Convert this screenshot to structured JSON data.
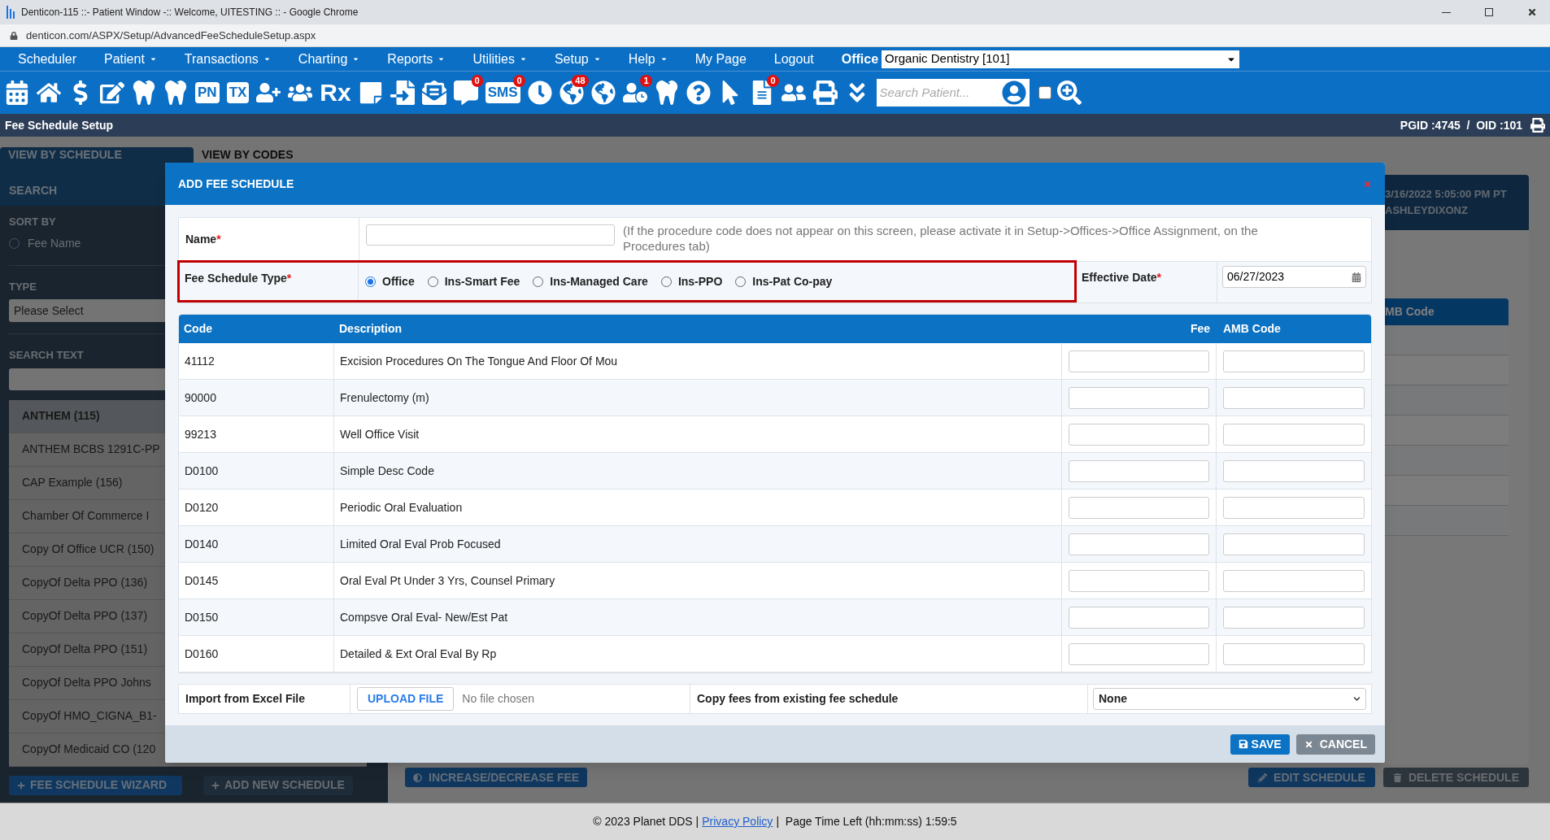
{
  "window": {
    "title": "Denticon-115 ::- Patient Window -:: Welcome, UITESTING :: - Google Chrome",
    "url": "denticon.com/ASPX/Setup/AdvancedFeeScheduleSetup.aspx"
  },
  "menu": [
    {
      "label": "Scheduler",
      "has_menu": false
    },
    {
      "label": "Patient",
      "has_menu": true
    },
    {
      "label": "Transactions",
      "has_menu": true
    },
    {
      "label": "Charting",
      "has_menu": true
    },
    {
      "label": "Reports",
      "has_menu": true
    },
    {
      "label": "Utilities",
      "has_menu": true
    },
    {
      "label": "Setup",
      "has_menu": true
    },
    {
      "label": "Help",
      "has_menu": true
    },
    {
      "label": "My Page",
      "has_menu": false
    },
    {
      "label": "Logout",
      "has_menu": false
    }
  ],
  "office": {
    "label": "Office",
    "value": "Organic Dentistry [101]"
  },
  "toolbar": [
    {
      "kind": "calendar"
    },
    {
      "kind": "home"
    },
    {
      "kind": "dollar"
    },
    {
      "kind": "edit"
    },
    {
      "kind": "tooth-card"
    },
    {
      "kind": "teeth"
    },
    {
      "kind": "text-card",
      "label": "PN"
    },
    {
      "kind": "text-card",
      "label": "TX"
    },
    {
      "kind": "user-plus"
    },
    {
      "kind": "users-plus"
    },
    {
      "kind": "text",
      "label": "Rx"
    },
    {
      "kind": "note"
    },
    {
      "kind": "scan"
    },
    {
      "kind": "mail"
    },
    {
      "kind": "chat",
      "badge": "0"
    },
    {
      "kind": "text-bubble",
      "label": "SMS",
      "badge": "0"
    },
    {
      "kind": "clock"
    },
    {
      "kind": "globe-user",
      "badge": "48"
    },
    {
      "kind": "globe-user"
    },
    {
      "kind": "user-sync",
      "badge": "1"
    },
    {
      "kind": "tooth"
    },
    {
      "kind": "question"
    },
    {
      "kind": "globe-pointer"
    },
    {
      "kind": "doc-check",
      "badge": "0"
    },
    {
      "kind": "family"
    },
    {
      "kind": "printer"
    },
    {
      "kind": "chevrons"
    }
  ],
  "patient_search": {
    "placeholder": "Search Patient...",
    "checked": false
  },
  "page_header": {
    "title": "Fee Schedule Setup",
    "ids": "PGID :4745  /  OID :101"
  },
  "tabs": [
    {
      "label": "VIEW BY SCHEDULE",
      "selected": true
    },
    {
      "label": "VIEW BY CODES",
      "selected": false
    }
  ],
  "sidebar": {
    "search_heading": "SEARCH",
    "sort_label": "SORT BY",
    "sort_options": [
      {
        "label": "Fee Name",
        "selected": false
      }
    ],
    "type_label": "TYPE",
    "type_value": "Please Select",
    "search_text_label": "SEARCH TEXT",
    "items": [
      {
        "label": "ANTHEM (115)",
        "selected": true
      },
      {
        "label": "ANTHEM BCBS 1291C-PP",
        "selected": false
      },
      {
        "label": "CAP Example (156)",
        "selected": false
      },
      {
        "label": "Chamber Of Commerce I",
        "selected": false
      },
      {
        "label": "Copy Of Office UCR (150)",
        "selected": false
      },
      {
        "label": "CopyOf Delta PPO (136)",
        "selected": false
      },
      {
        "label": "CopyOf Delta PPO (137)",
        "selected": false
      },
      {
        "label": "CopyOf Delta PPO (151)",
        "selected": false
      },
      {
        "label": "CopyOf Delta PPO Johns",
        "selected": false
      },
      {
        "label": "CopyOf HMO_CIGNA_B1-",
        "selected": false
      },
      {
        "label": "CopyOf Medicaid CO (120",
        "selected": false
      }
    ],
    "buttons": [
      "FEE SCHEDULE WIZARD",
      "ADD NEW SCHEDULE"
    ]
  },
  "main": {
    "info": [
      "3/16/2022 5:05:00 PM PT",
      "ASHLEYDIXONZ"
    ],
    "column": "MB Code",
    "buttons": [
      "INCREASE/DECREASE FEE",
      "EDIT SCHEDULE",
      "DELETE SCHEDULE"
    ]
  },
  "modal": {
    "title": "ADD FEE SCHEDULE",
    "name_label": "Name",
    "name_mark": "*",
    "name_hint": "(If the procedure code does not appear on this screen, please activate it in Setup->Offices->Office Assignment, on the Procedures tab)",
    "type_label": "Fee Schedule Type",
    "type_mark": "*",
    "types": [
      {
        "label": "Office",
        "selected": true
      },
      {
        "label": "Ins-Smart Fee",
        "selected": false
      },
      {
        "label": "Ins-Managed Care",
        "selected": false
      },
      {
        "label": "Ins-PPO",
        "selected": false
      },
      {
        "label": "Ins-Pat Co-pay",
        "selected": false
      }
    ],
    "date_label": "Effective Date",
    "date_mark": "*",
    "date_value": "06/27/2023",
    "columns": [
      "Code",
      "Description",
      "Fee",
      "AMB Code"
    ],
    "rows": [
      {
        "code": "41112",
        "description": "Excision Procedures On The Tongue And Floor Of Mou"
      },
      {
        "code": "90000",
        "description": "Frenulectomy (m)"
      },
      {
        "code": "99213",
        "description": "Well Office Visit"
      },
      {
        "code": "D0100",
        "description": "Simple Desc Code"
      },
      {
        "code": "D0120",
        "description": "Periodic Oral Evaluation"
      },
      {
        "code": "D0140",
        "description": "Limited Oral Eval Prob Focused"
      },
      {
        "code": "D0145",
        "description": "Oral Eval Pt Under 3 Yrs, Counsel Primary"
      },
      {
        "code": "D0150",
        "description": "Compsve Oral Eval- New/Est Pat"
      },
      {
        "code": "D0160",
        "description": "Detailed & Ext Oral Eval By Rp"
      }
    ],
    "import_label": "Import from Excel File",
    "upload": "UPLOAD FILE",
    "file_status": "No file chosen",
    "copy_label": "Copy fees from existing fee schedule",
    "copy_value": "None",
    "save": "SAVE",
    "cancel": "CANCEL"
  },
  "footer": {
    "copyright": "© 2023 Planet DDS |",
    "link": "Privacy Policy",
    "time": "|  Page Time Left (hh:mm:ss) 1:59:5"
  }
}
